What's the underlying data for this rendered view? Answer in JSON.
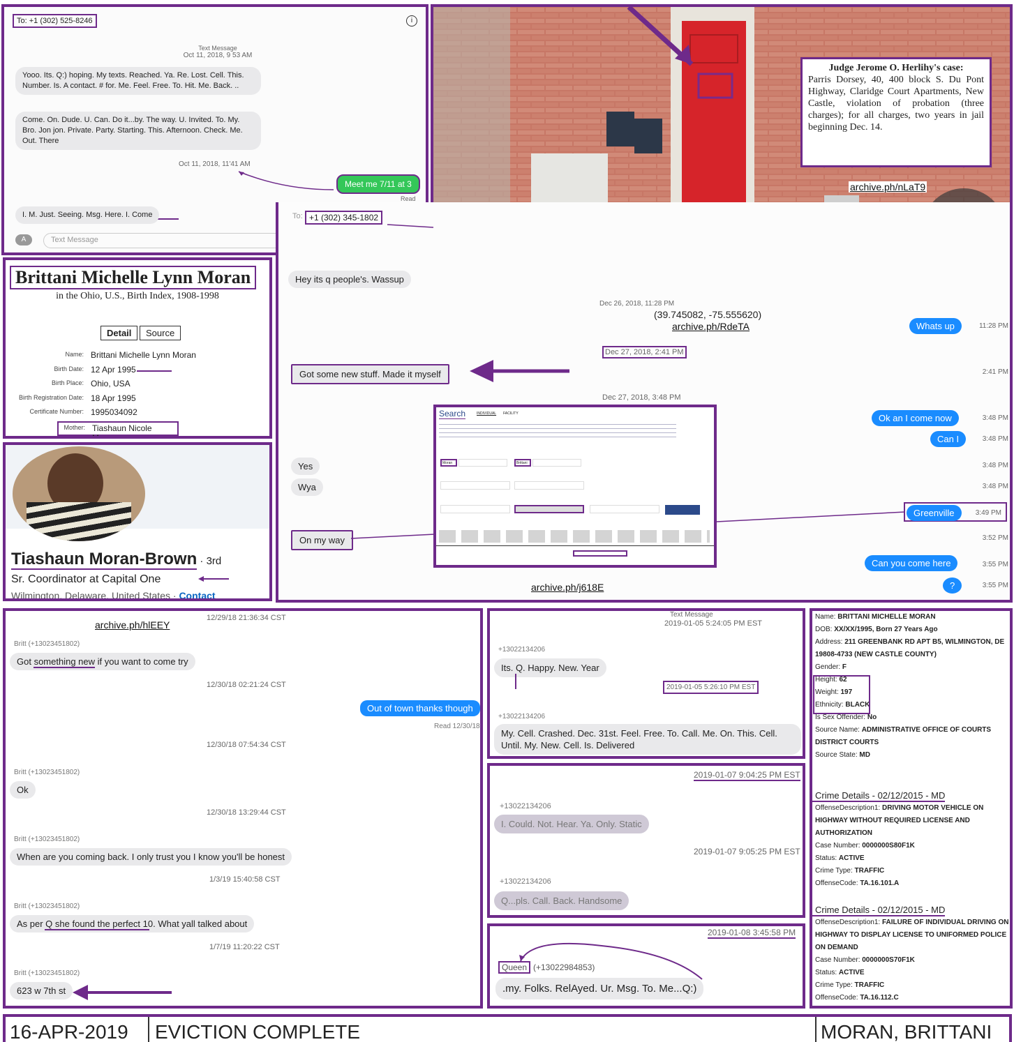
{
  "p1": {
    "to": "To: +1 (302) 525-8246",
    "header": "Text Message",
    "date1": "Oct 11, 2018, 9 53 AM",
    "msg1": "Yooo. Its. Q:) hoping. My texts. Reached. Ya. Re. Lost. Cell. This. Number. Is. A contact. # for. Me. Feel. Free. To. Hit. Me. Back. ..",
    "msg2": "Come. On. Dude. U. Can. Do it...by. The way.   U. Invited. To. My. Bro. Jon jon. Private. Party. Starting. This. Afternoon.   Check. Me. Out. There",
    "date2": "Oct 11, 2018, 11'41 AM",
    "sent": "Meet me 7/11 at 3",
    "read": "Read",
    "msg3": "I. M. Just. Seeing. Msg. Here. I. Come",
    "input_ph": "Text Message"
  },
  "p2": {
    "title": "Judge Jerome O. Herlihy's case:",
    "body": "Parris Dorsey, 40, 400 block S. Du Pont Highway, Claridge Court Apartments, New Castle, violation of probation (three charges); for all charges, two years in jail beginning Dec. 14.",
    "link": "archive.ph/nLaT9"
  },
  "p3": {
    "name": "Brittani Michelle Lynn Moran",
    "sub": "in the Ohio, U.S., Birth Index, 1908-1998",
    "tab1": "Detail",
    "tab2": "Source",
    "rows": [
      {
        "k": "Name:",
        "v": "Brittani Michelle Lynn Moran"
      },
      {
        "k": "Birth Date:",
        "v": "12 Apr 1995"
      },
      {
        "k": "Birth Place:",
        "v": "Ohio, USA"
      },
      {
        "k": "Birth Registration Date:",
        "v": "18 Apr 1995"
      },
      {
        "k": "Certificate Number:",
        "v": "1995034092"
      },
      {
        "k": "Mother:",
        "v": "Tiashaun Nicole Moran"
      }
    ]
  },
  "p4": {
    "name": "Tiashaun Moran-Brown",
    "degree": " · 3rd",
    "title": "Sr. Coordinator at Capital One",
    "loc": "Wilmington, Delaware, United States · ",
    "contact": "Contact"
  },
  "p5": {
    "to": "To:",
    "number": "+1 (302) 345-1802",
    "m1": "Hey its q people's. Wassup",
    "d1": "Dec 26, 2018, 11:28 PM",
    "coords": "(39.745082, -75.555620)",
    "coordlink": "archive.ph/RdeTA",
    "b1": "Whats up",
    "t1": "11:28 PM",
    "d2": "Dec 27, 2018, 2:41 PM",
    "m2": "Got some new stuff. Made it myself",
    "t2": "2:41 PM",
    "d3": "Dec 27, 2018, 3:48 PM",
    "b2": "Ok an I come now",
    "t3": "3:48 PM",
    "b3": "Can I",
    "t4": "3:48 PM",
    "m3": "Yes",
    "t5": "3:48 PM",
    "m4": "Wya",
    "t6": "3:48 PM",
    "b4": "Greenville",
    "t7": "3:49 PM",
    "m5": "On my way",
    "t8": "3:52 PM",
    "b5": "Can you come here",
    "t9": "3:55 PM",
    "b6": "?",
    "t10": "3:55 PM",
    "link": "archive.ph/j618E",
    "search": {
      "title": "Search",
      "tab1": "INDIVIDUAL",
      "tab2": "FACILITY",
      "field1": "Moran",
      "field2": "Brittani"
    }
  },
  "p6": {
    "link": "archive.ph/hlEEY",
    "top_time": "12/29/18 21:36:34 CST",
    "s1": "Britt (+13023451802)",
    "m1": "Got something new if you want to come try",
    "t1": "12/30/18 02:21:24 CST",
    "b1": "Out of town thanks though",
    "read": "Read 12/30/18",
    "t2": "12/30/18 07:54:34 CST",
    "s2": "Britt (+13023451802)",
    "m2": "Ok",
    "t3": "12/30/18 13:29:44 CST",
    "s3": "Britt (+13023451802)",
    "m3": "When are you coming back. I only trust you I know you'll be honest",
    "t4": "1/3/19 15:40:58 CST",
    "s4": "Britt (+13023451802)",
    "m4": "As per Q she found the perfect 10. What yall talked about",
    "t5": "1/7/19 11:20:22 CST",
    "s5": "Britt (+13023451802)",
    "m5": "623 w 7th st"
  },
  "p7": {
    "hdr": "Text Message",
    "date": "2019-01-05 5:24:05 PM EST",
    "s1": "+13022134206",
    "m1": "Its. Q. Happy. New. Year",
    "date2": "2019-01-05 5:26:10 PM EST",
    "s2": "+13022134206",
    "m2": "My. Cell. Crashed. Dec. 31st. Feel. Free. To. Call. Me. On. This. Cell.  Until. My. New. Cell. Is. Delivered"
  },
  "p8": {
    "date": "2019-01-07 9:04:25 PM EST",
    "s1": "+13022134206",
    "m1": "I. Could. Not. Hear. Ya. Only. Static",
    "date2": "2019-01-07 9:05:25 PM EST",
    "s2": "+13022134206",
    "m2": "Q...pls. Call. Back. Handsome"
  },
  "p9": {
    "date": "2019-01-08 3:45:58 PM",
    "sender_tag": "Queen",
    "sender": "(+13022984853)",
    "msg": ".my. Folks. RelAyed. Ur. Msg. To. Me...Q:)"
  },
  "p10": {
    "lines": [
      {
        "k": "Name: ",
        "v": "BRITTANI MICHELLE MORAN"
      },
      {
        "k": "DOB: ",
        "v": "XX/XX/1995, Born 27 Years Ago"
      },
      {
        "k": "Address: ",
        "v": "211 GREENBANK RD APT B5, WILMINGTON, DE 19808-4733 (NEW CASTLE COUNTY)"
      },
      {
        "k": "Gender: ",
        "v": "F"
      },
      {
        "k": "Height: ",
        "v": "62"
      },
      {
        "k": "Weight: ",
        "v": "197"
      },
      {
        "k": "Ethnicity: ",
        "v": "BLACK"
      },
      {
        "k": "Is Sex Offender: ",
        "v": "No"
      },
      {
        "k": "Source Name: ",
        "v": "ADMINISTRATIVE OFFICE OF COURTS DISTRICT COURTS"
      },
      {
        "k": "Source State: ",
        "v": "MD"
      }
    ],
    "c1": {
      "title": "Crime Details  - 02/12/2015 - MD",
      "lines": [
        {
          "k": "OffenseDescription1: ",
          "v": "DRIVING MOTOR VEHICLE ON HIGHWAY WITHOUT REQUIRED LICENSE AND AUTHORIZATION"
        },
        {
          "k": "Case Number: ",
          "v": "0000000S80F1K"
        },
        {
          "k": "Status: ",
          "v": "ACTIVE"
        },
        {
          "k": "Crime Type: ",
          "v": "TRAFFIC"
        },
        {
          "k": "OffenseCode: ",
          "v": "TA.16.101.A"
        }
      ]
    },
    "c2": {
      "title": "Crime Details  - 02/12/2015 - MD",
      "lines": [
        {
          "k": "OffenseDescription1: ",
          "v": "FAILURE OF INDIVIDUAL DRIVING ON HIGHWAY TO DISPLAY LICENSE TO UNIFORMED POLICE ON DEMAND"
        },
        {
          "k": "Case Number: ",
          "v": "0000000S70F1K"
        },
        {
          "k": "Status: ",
          "v": "ACTIVE"
        },
        {
          "k": "Crime Type: ",
          "v": "TRAFFIC"
        },
        {
          "k": "OffenseCode: ",
          "v": "TA.16.112.C"
        }
      ]
    }
  },
  "footer": {
    "date": "16-APR-2019",
    "status": "EVICTION COMPLETE",
    "name": "MORAN, BRITTANI"
  }
}
